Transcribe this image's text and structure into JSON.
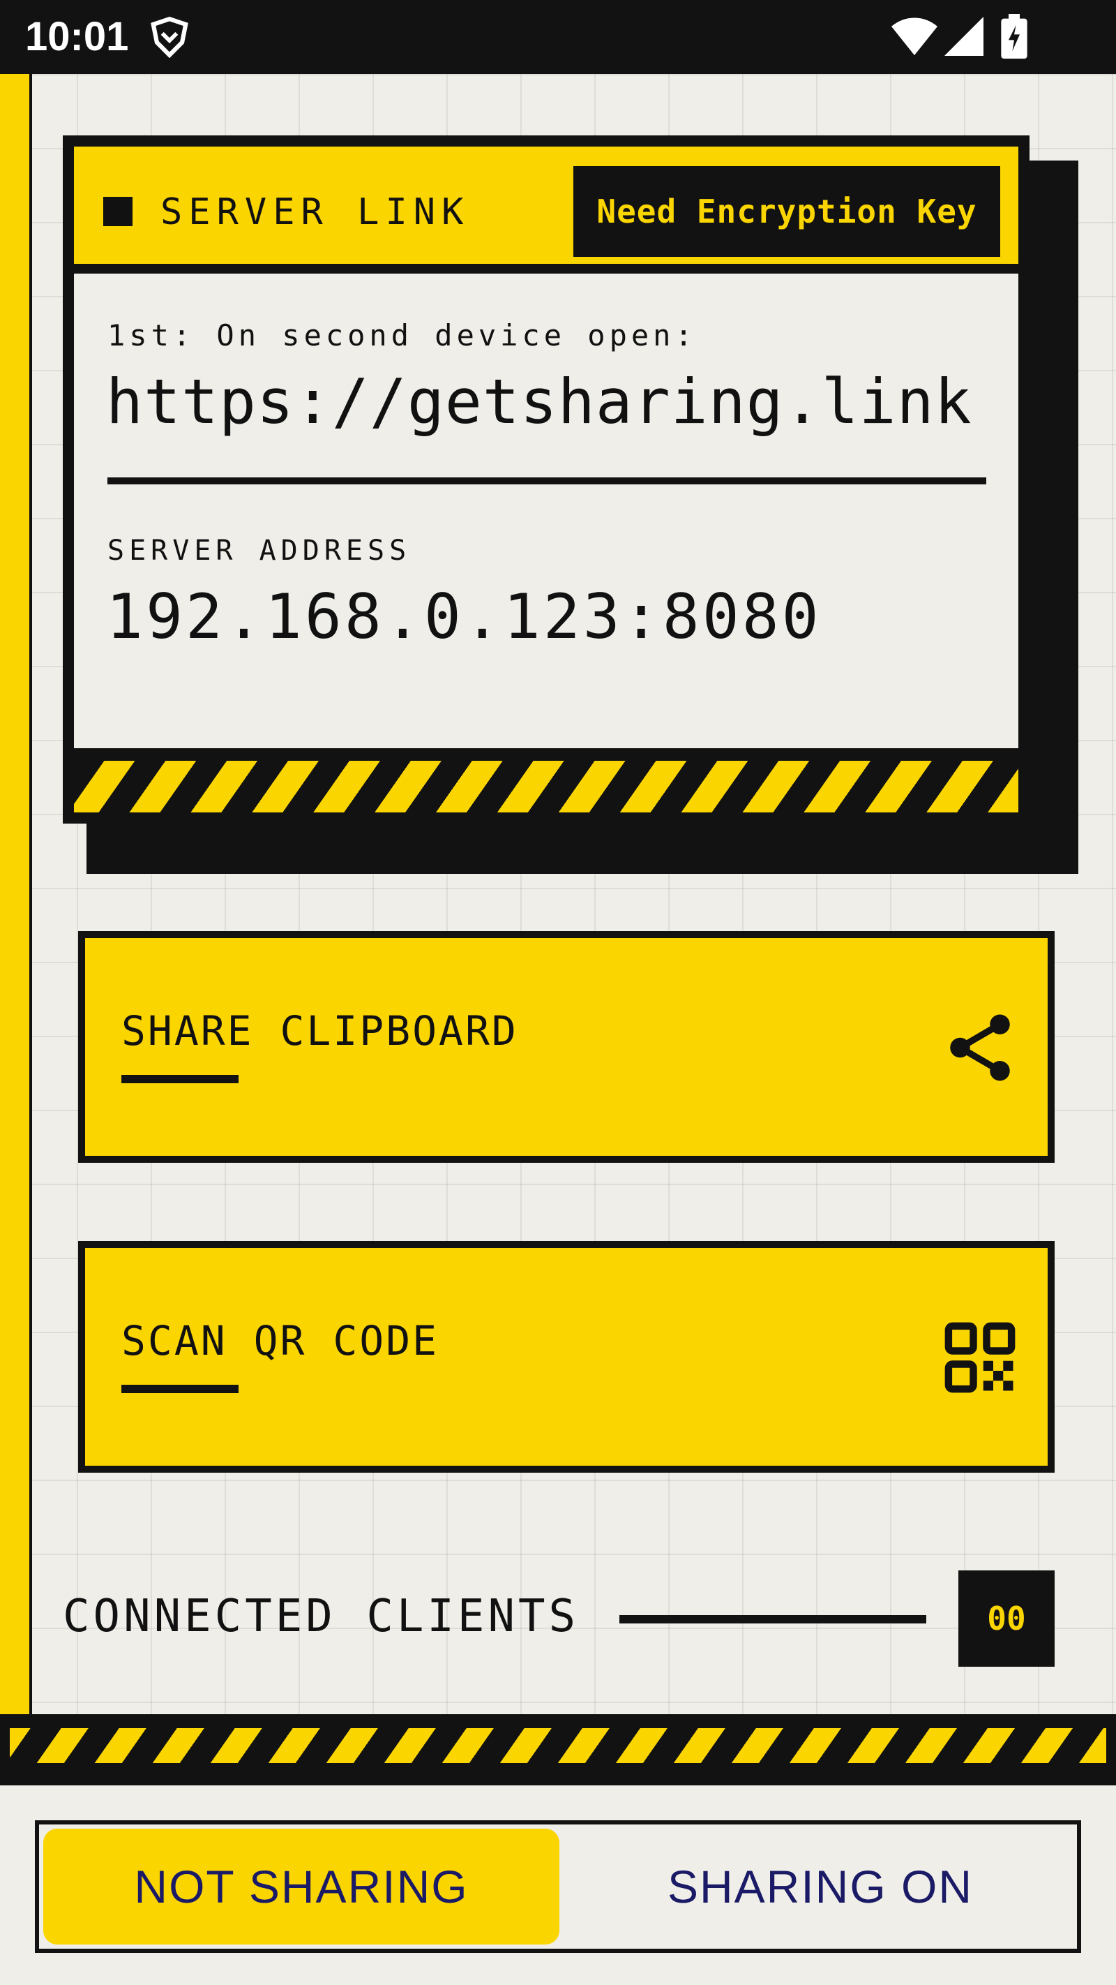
{
  "status_bar": {
    "time": "10:01",
    "icons": [
      "vpn-shield-icon",
      "wifi-icon",
      "signal-icon",
      "battery-charging-icon"
    ]
  },
  "colors": {
    "accent": "#fbd500",
    "dark": "#121212",
    "background": "#efeee8",
    "toggle_text": "#1a1a66"
  },
  "server_card": {
    "title": "SERVER LINK",
    "encryption_badge": "Need Encryption Key",
    "instruction": "1st: On second device open:",
    "link": "https://getsharing.link",
    "address_label": "SERVER ADDRESS",
    "address": "192.168.0.123:8080"
  },
  "actions": {
    "share": {
      "label": "SHARE CLIPBOARD",
      "icon": "share-icon"
    },
    "scan": {
      "label": "SCAN QR CODE",
      "icon": "qr-code-icon"
    }
  },
  "clients": {
    "label": "CONNECTED CLIENTS",
    "count": "00"
  },
  "sharing_toggle": {
    "off_label": "NOT SHARING",
    "on_label": "SHARING ON",
    "selected": "NOT SHARING"
  }
}
